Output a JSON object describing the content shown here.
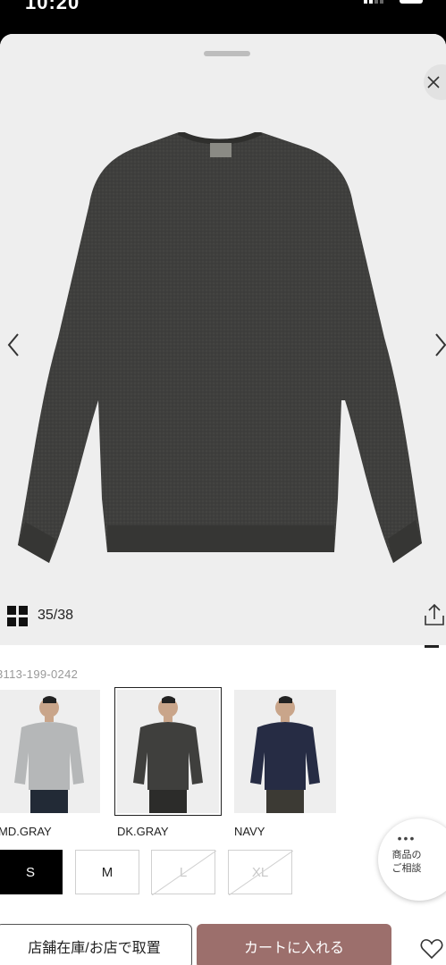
{
  "status_bar": {
    "time": "10:20",
    "indicators": ""
  },
  "gallery": {
    "counter": "35/38",
    "product_color": "#3f3f3d"
  },
  "product": {
    "code": "3113-199-0242"
  },
  "colors": [
    {
      "label": "MD.GRAY",
      "sweater_hex": "#b5b7b8",
      "selected": false
    },
    {
      "label": "DK.GRAY",
      "sweater_hex": "#3f3f3d",
      "selected": true
    },
    {
      "label": "NAVY",
      "sweater_hex": "#262c44",
      "selected": false
    }
  ],
  "sizes": [
    {
      "label": "S",
      "state": "selected"
    },
    {
      "label": "M",
      "state": "available"
    },
    {
      "label": "L",
      "state": "unavailable"
    },
    {
      "label": "XL",
      "state": "unavailable"
    }
  ],
  "consult": {
    "dots": "•••",
    "line1": "商品の",
    "line2": "ご相談"
  },
  "actions": {
    "store_label": "店舗在庫/お店で取置",
    "cart_label": "カートに入れる"
  },
  "theme": {
    "accent": "#9c6f6c",
    "gallery_bg": "#eeeeee"
  }
}
